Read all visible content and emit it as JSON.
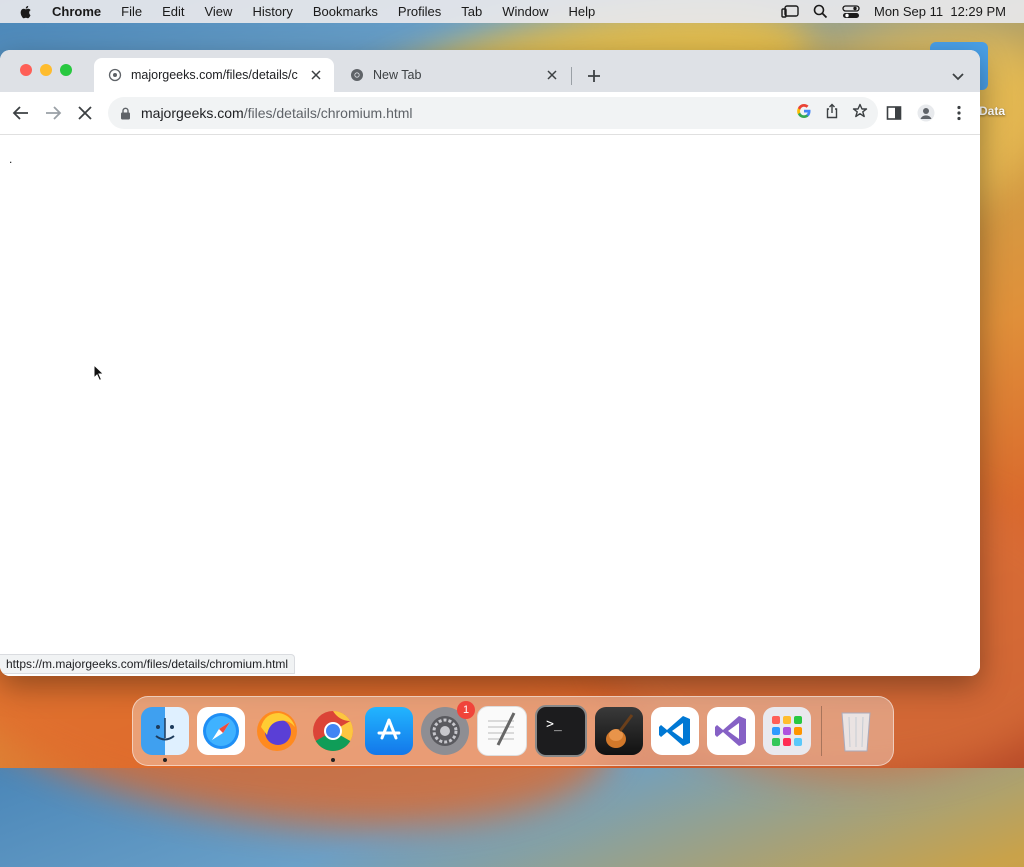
{
  "menubar": {
    "app_name": "Chrome",
    "items": [
      "File",
      "Edit",
      "View",
      "History",
      "Bookmarks",
      "Profiles",
      "Tab",
      "Window",
      "Help"
    ],
    "clock": "Mon Sep 11  12:29 PM"
  },
  "desktop": {
    "item_label": "Data"
  },
  "browser": {
    "tabs": [
      {
        "title": "majorgeeks.com/files/details/c",
        "active": true
      },
      {
        "title": "New Tab",
        "active": false
      }
    ],
    "omnibox": {
      "host": "majorgeeks.com",
      "path": "/files/details/chromium.html"
    },
    "content_text": ".",
    "status_url": "https://m.majorgeeks.com/files/details/chromium.html"
  },
  "dock": {
    "apps": [
      "finder-icon",
      "safari-icon",
      "firefox-icon",
      "chrome-icon",
      "app-store-icon",
      "system-settings-icon",
      "textedit-icon",
      "terminal-icon",
      "garageband-icon",
      "vscode-icon",
      "visual-studio-icon",
      "launchpad-icon",
      "trash-icon"
    ],
    "settings_badge": "1"
  }
}
